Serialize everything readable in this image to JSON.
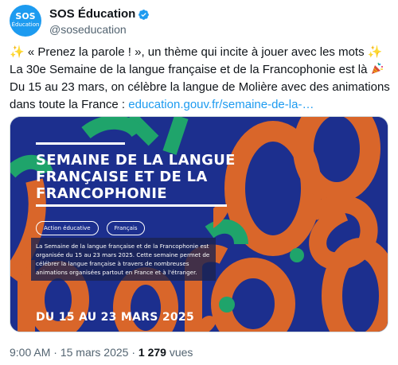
{
  "author": {
    "display_name": "SOS Éducation",
    "handle": "@soseducation",
    "avatar_line1": "SOS",
    "avatar_line2": "Éducation"
  },
  "tweet": {
    "line1_spark_left": "✨",
    "line1_text": " « Prenez la parole ! », un thème qui incite à jouer avec les mots ",
    "line1_spark_right": "✨",
    "line2_text": "La 30e Semaine de la langue française et de la Francophonie est là ",
    "line3_text": "Du 15 au 23 mars, on célèbre la langue de Molière avec des animations",
    "line4_text": "dans toute la France : ",
    "link_text": "education.gouv.fr/semaine-de-la-…"
  },
  "media": {
    "title_line1": "SEMAINE DE LA LANGUE",
    "title_line2": "FRANÇAISE ET DE LA",
    "title_line3": "FRANCOPHONIE",
    "tags": [
      "Action éducative",
      "Français"
    ],
    "description": "La Semaine de la langue française et de la Francophonie est organisée du 15 au 23 mars 2025. Cette semaine permet de célébrer la langue française à travers de nombreuses animations organisées partout en France et à l'étranger.",
    "date": "DU 15 AU 23 MARS 2025",
    "colors": {
      "background": "#1c2f8e",
      "orange": "#d9662a",
      "green": "#1fa46b",
      "white": "#ffffff"
    }
  },
  "meta": {
    "time": "9:00 AM",
    "separator": " · ",
    "date": "15 mars 2025",
    "views_count": "1 279",
    "views_label": " vues"
  },
  "colors": {
    "verified": "#1d9bf0",
    "link": "#1d9bf0",
    "muted": "#536471"
  }
}
